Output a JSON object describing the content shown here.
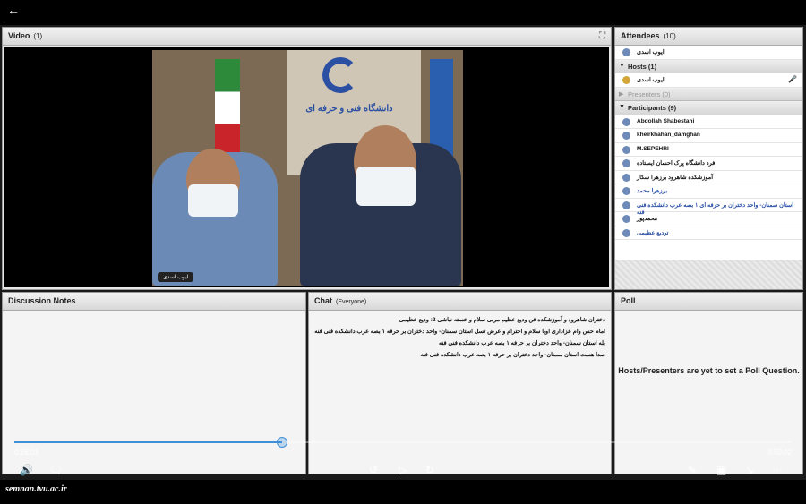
{
  "video": {
    "title": "Video",
    "count": "(1)",
    "speaker_name": "ایوب اسدی",
    "logo_text": "دانشگاه فنی و حرفه ای"
  },
  "attendees": {
    "title": "Attendees",
    "count": "(10)",
    "me": "ایوب اسدی",
    "hosts_label": "Hosts (1)",
    "host": "ایوب اسدی",
    "presenters_label": "Presenters (0)",
    "participants_label": "Participants (9)",
    "participants": [
      "Abdollah Shabestani",
      "kheirkhahan_damghan",
      "M.SEPEHRI",
      "فرد دانشگاه پرک احسان ایستاده",
      "آموزشکده شاهرود برزهرا سکار",
      "برزهرا محمد",
      "استان سمنان- واحد دختران بر حرفه ای ۱ بصه عرب دانشکده فنی فنه",
      "محمدپور",
      "تودیع عظیمی"
    ]
  },
  "notes": {
    "title": "Discussion Notes"
  },
  "chat": {
    "title": "Chat",
    "scope": "(Everyone)",
    "messages": [
      "دختران شاهرود و آموزشکده فن ودیع عظیم مربی سلام و خسته نباشی 2: ودیع عظیمی",
      "امام حس وام عزاداری اویا سلام و احترام و عرض تسل استان سمنان- واحد دختران بر حرفه ۱ بصه عرب دانشکده فنی فنه",
      "بله استان سمنان- واحد دختران بر حرفه ۱ بصه عرب دانشکده فنی فنه",
      "صدا هست استان سمنان- واحد دختران بر حرفه ۱ بصه عرب دانشکده فنی فنه"
    ]
  },
  "poll": {
    "title": "Poll",
    "message": "Hosts/Presenters are yet to set a Poll Question."
  },
  "player": {
    "current_time": "0:26:03",
    "total_time": "0:50:02",
    "progress": 0.345
  },
  "footer": {
    "site": "semnan.tvu.ac.ir"
  },
  "colors": {
    "accent": "#3d8fd8",
    "pod_header": "#d8d8d8"
  }
}
